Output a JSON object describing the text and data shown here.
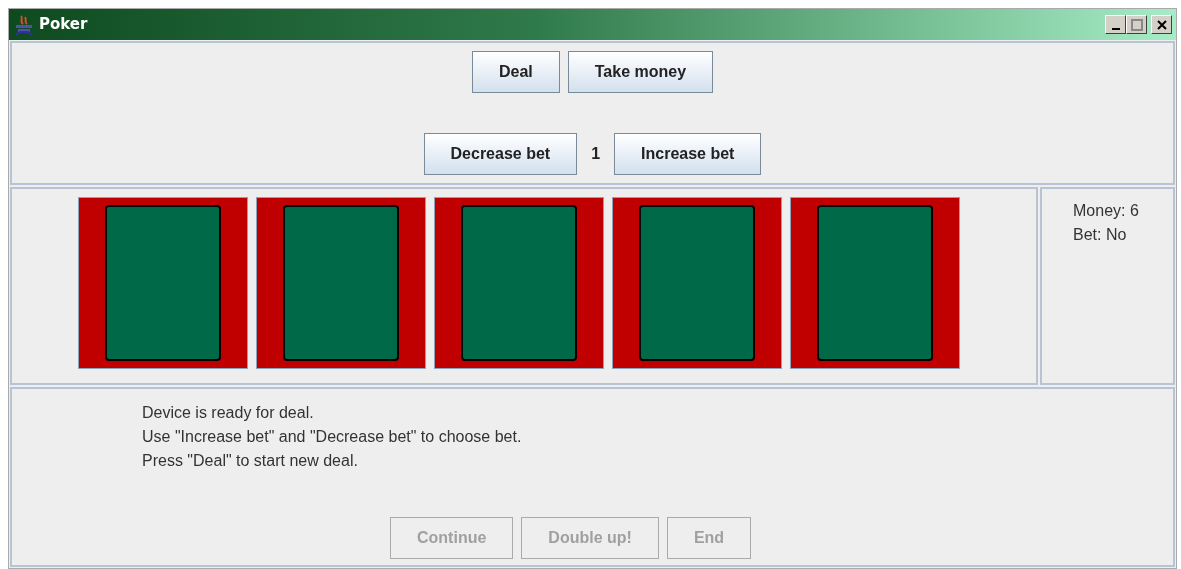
{
  "window": {
    "title": "Poker"
  },
  "top_buttons": [
    {
      "label": "Deal",
      "disabled": false
    },
    {
      "label": "Take money",
      "disabled": false
    }
  ],
  "bet": {
    "decrease_label": "Decrease bet",
    "value": "1",
    "increase_label": "Increase bet"
  },
  "cards": [
    {
      "kind": "back"
    },
    {
      "kind": "back"
    },
    {
      "kind": "back"
    },
    {
      "kind": "back"
    },
    {
      "kind": "back"
    }
  ],
  "status": [
    "Money: 6",
    "Bet: No"
  ],
  "messages": [
    "Device is ready for deal.",
    "Use \"Increase bet\" and \"Decrease bet\" to choose bet.",
    "Press \"Deal\" to start new deal."
  ],
  "bottom_buttons": [
    {
      "label": "Continue",
      "disabled": true
    },
    {
      "label": "Double up!",
      "disabled": true
    },
    {
      "label": "End",
      "disabled": true
    }
  ]
}
